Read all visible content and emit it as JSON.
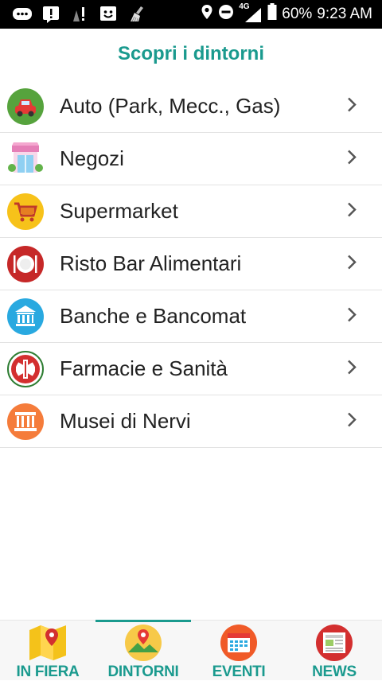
{
  "status": {
    "network": "4G",
    "battery": "60%",
    "time": "9:23 AM"
  },
  "header": {
    "title": "Scopri i dintorni"
  },
  "categories": [
    {
      "label": "Auto (Park, Mecc., Gas)",
      "icon": "car-icon"
    },
    {
      "label": "Negozi",
      "icon": "shop-icon"
    },
    {
      "label": "Supermarket",
      "icon": "cart-icon"
    },
    {
      "label": "Risto Bar Alimentari",
      "icon": "restaurant-icon"
    },
    {
      "label": "Banche e Bancomat",
      "icon": "bank-icon"
    },
    {
      "label": "Farmacie e Sanità",
      "icon": "pharmacy-icon"
    },
    {
      "label": "Musei di Nervi",
      "icon": "museum-icon"
    }
  ],
  "tabs": [
    {
      "label": "IN FIERA",
      "icon": "map-pin-icon",
      "active": false
    },
    {
      "label": "DINTORNI",
      "icon": "nearby-icon",
      "active": true
    },
    {
      "label": "EVENTI",
      "icon": "calendar-icon",
      "active": false
    },
    {
      "label": "NEWS",
      "icon": "newspaper-icon",
      "active": false
    }
  ],
  "colors": {
    "accent": "#1a9a8e",
    "statusbar": "#000000",
    "text": "#222222"
  }
}
